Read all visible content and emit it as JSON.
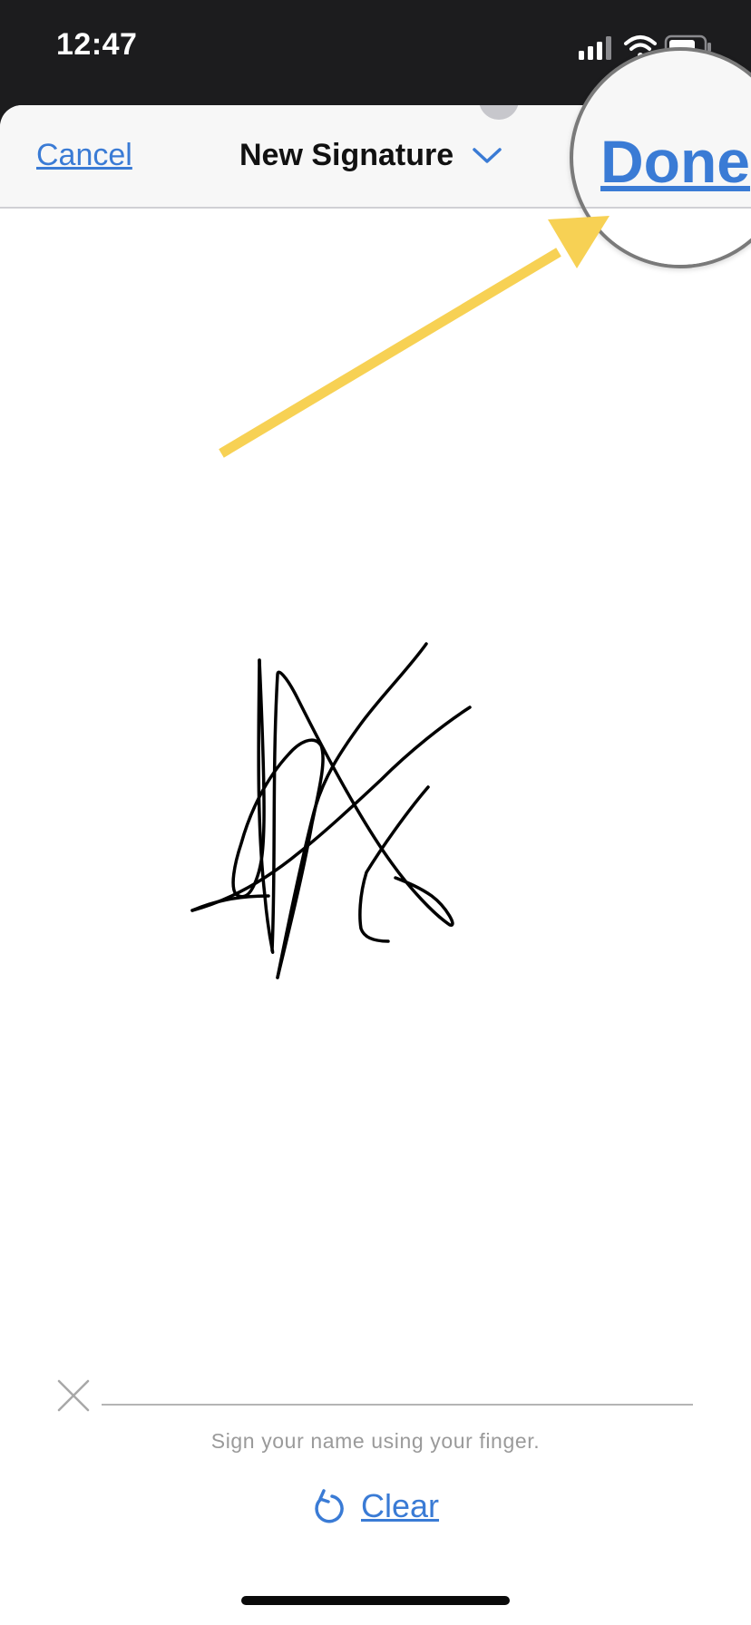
{
  "status_bar": {
    "time": "12:47"
  },
  "nav": {
    "cancel_label": "Cancel",
    "title": "New Signature",
    "done_label": "Done"
  },
  "signature_pad": {
    "hint": "Sign your name using your finger.",
    "clear_label": "Clear"
  },
  "colors": {
    "accent": "#3a7bd5",
    "annotation_arrow": "#f7d154"
  },
  "icons": {
    "cellular": "cellular-signal-icon",
    "wifi": "wifi-icon",
    "battery": "battery-icon",
    "title_chevron": "chevron-down-icon",
    "sign_here": "x-mark-icon",
    "clear": "undo-arrow-icon"
  }
}
